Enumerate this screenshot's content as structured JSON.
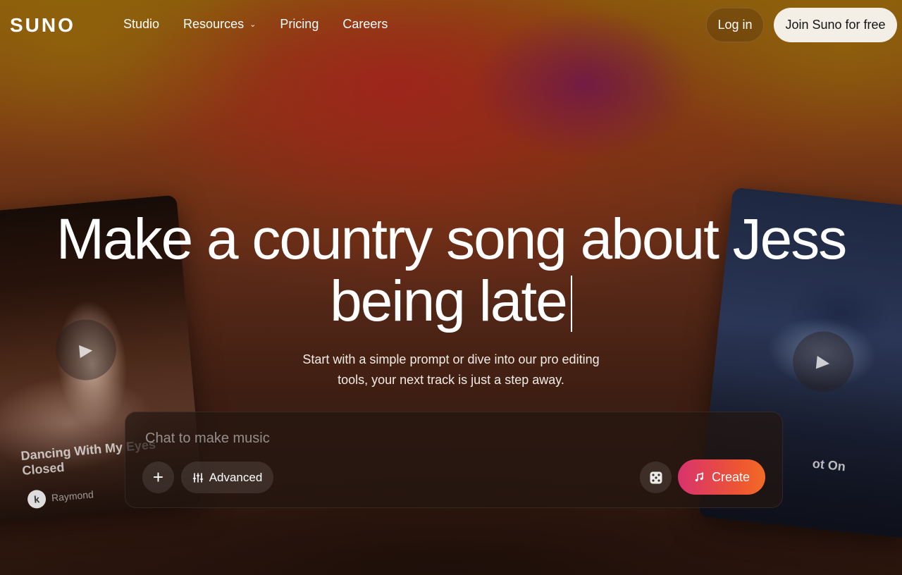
{
  "brand": {
    "logo_text": "SUNO"
  },
  "nav": {
    "links": [
      "Studio",
      "Resources",
      "Pricing",
      "Careers"
    ],
    "login_label": "Log in",
    "join_label": "Join Suno for free"
  },
  "hero": {
    "title_line1": "Make a country song about Jess",
    "title_line2": "being late",
    "subtitle_line1": "Start with a simple prompt or dive into our pro editing",
    "subtitle_line2": "tools, your next track is just a step away."
  },
  "chat": {
    "placeholder": "Chat to make music",
    "advanced_label": "Advanced",
    "create_label": "Create"
  },
  "cards": {
    "left": {
      "title": "Dancing With My Eyes Closed",
      "artist": "Raymond",
      "avatar_letter": "k"
    },
    "right": {
      "title": "ot On"
    }
  },
  "colors": {
    "create_gradient_start": "#d8336e",
    "create_gradient_end": "#f26b26",
    "join_bg": "#f4efe6"
  },
  "icons": [
    "chevron-down-icon",
    "play-icon",
    "plus-icon",
    "sliders-icon",
    "dice-icon",
    "music-note-sparkle-icon"
  ]
}
